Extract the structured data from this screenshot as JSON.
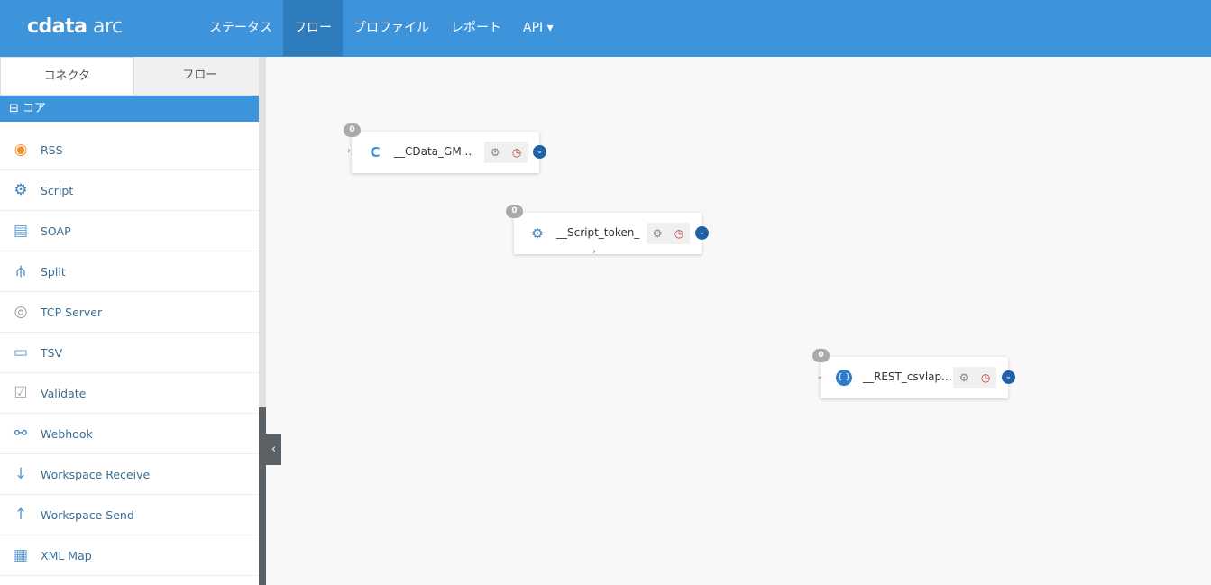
{
  "header": {
    "logo_bold": "cdata",
    "logo_light": " arc",
    "nav": [
      "ステータス",
      "フロー",
      "プロファイル",
      "レポート",
      "API ▾"
    ],
    "active": "フロー"
  },
  "sidebar": {
    "tabs": [
      "コネクタ",
      "フロー"
    ],
    "category": "⊟ コア",
    "items": [
      {
        "label": "RSS",
        "icon": "rss-icon"
      },
      {
        "label": "Script",
        "icon": "script-icon"
      },
      {
        "label": "SOAP",
        "icon": "soap-icon"
      },
      {
        "label": "Split",
        "icon": "split-icon"
      },
      {
        "label": "TCP Server",
        "icon": "tcp-icon"
      },
      {
        "label": "TSV",
        "icon": "tsv-icon"
      },
      {
        "label": "Validate",
        "icon": "validate-icon"
      },
      {
        "label": "Webhook",
        "icon": "webhook-icon"
      },
      {
        "label": "Workspace Receive",
        "icon": "download-icon"
      },
      {
        "label": "Workspace Send",
        "icon": "upload-icon"
      },
      {
        "label": "XML Map",
        "icon": "xmlmap-icon"
      }
    ]
  },
  "canvas": {
    "nodes": [
      {
        "label": "__CData_GM...",
        "count": "0",
        "icon": "cdata-icon"
      },
      {
        "label": "__Script_token_",
        "count": "0",
        "icon": "script-icon"
      },
      {
        "label": "__REST_csvlap...",
        "count": "0",
        "icon": "rest-icon"
      }
    ]
  },
  "colors": {
    "accent": "#3d94db",
    "active_nav": "#2f7cbd",
    "chevron": "#2060a8"
  }
}
